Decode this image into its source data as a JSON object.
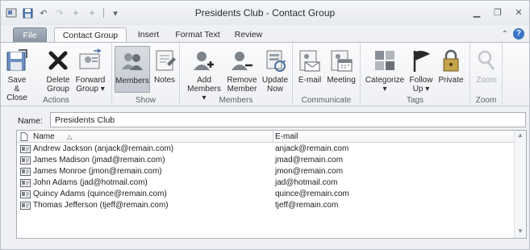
{
  "window": {
    "title": "Presidents Club - Contact Group"
  },
  "tabs": [
    {
      "label": "File"
    },
    {
      "label": "Contact Group"
    },
    {
      "label": "Insert"
    },
    {
      "label": "Format Text"
    },
    {
      "label": "Review"
    }
  ],
  "ribbon": {
    "groups": {
      "actions": "Actions",
      "show": "Show",
      "members": "Members",
      "communicate": "Communicate",
      "tags": "Tags",
      "zoom": "Zoom"
    },
    "buttons": {
      "save_close": [
        "Save &",
        "Close"
      ],
      "delete_group": [
        "Delete",
        "Group"
      ],
      "forward_group": [
        "Forward",
        "Group ▾"
      ],
      "members": [
        "Members",
        ""
      ],
      "notes": [
        "Notes",
        ""
      ],
      "add_members": [
        "Add",
        "Members ▾"
      ],
      "remove_member": [
        "Remove",
        "Member"
      ],
      "update_now": [
        "Update",
        "Now"
      ],
      "email": [
        "E-mail",
        ""
      ],
      "meeting": [
        "Meeting",
        ""
      ],
      "categorize": [
        "Categorize",
        "▾"
      ],
      "follow_up": [
        "Follow",
        "Up ▾"
      ],
      "private": [
        "Private",
        ""
      ],
      "zoom": [
        "Zoom",
        ""
      ]
    }
  },
  "name_field": {
    "label": "Name:",
    "value": "Presidents Club"
  },
  "list": {
    "columns": {
      "name": "Name",
      "email": "E-mail"
    },
    "rows": [
      {
        "name": "Andrew Jackson (anjack@remain.com)",
        "email": "anjack@remain.com"
      },
      {
        "name": "James Madison (jmad@remain.com)",
        "email": "jmad@remain.com"
      },
      {
        "name": "James Monroe (jmon@remain.com)",
        "email": "jmon@remain.com"
      },
      {
        "name": "John Adams (jad@hotmail.com)",
        "email": "jad@hotmail.com"
      },
      {
        "name": "Quincy Adams (quince@remain.com)",
        "email": "quince@remain.com"
      },
      {
        "name": "Thomas Jefferson (tjeff@remain.com)",
        "email": "tjeff@remain.com"
      }
    ]
  }
}
